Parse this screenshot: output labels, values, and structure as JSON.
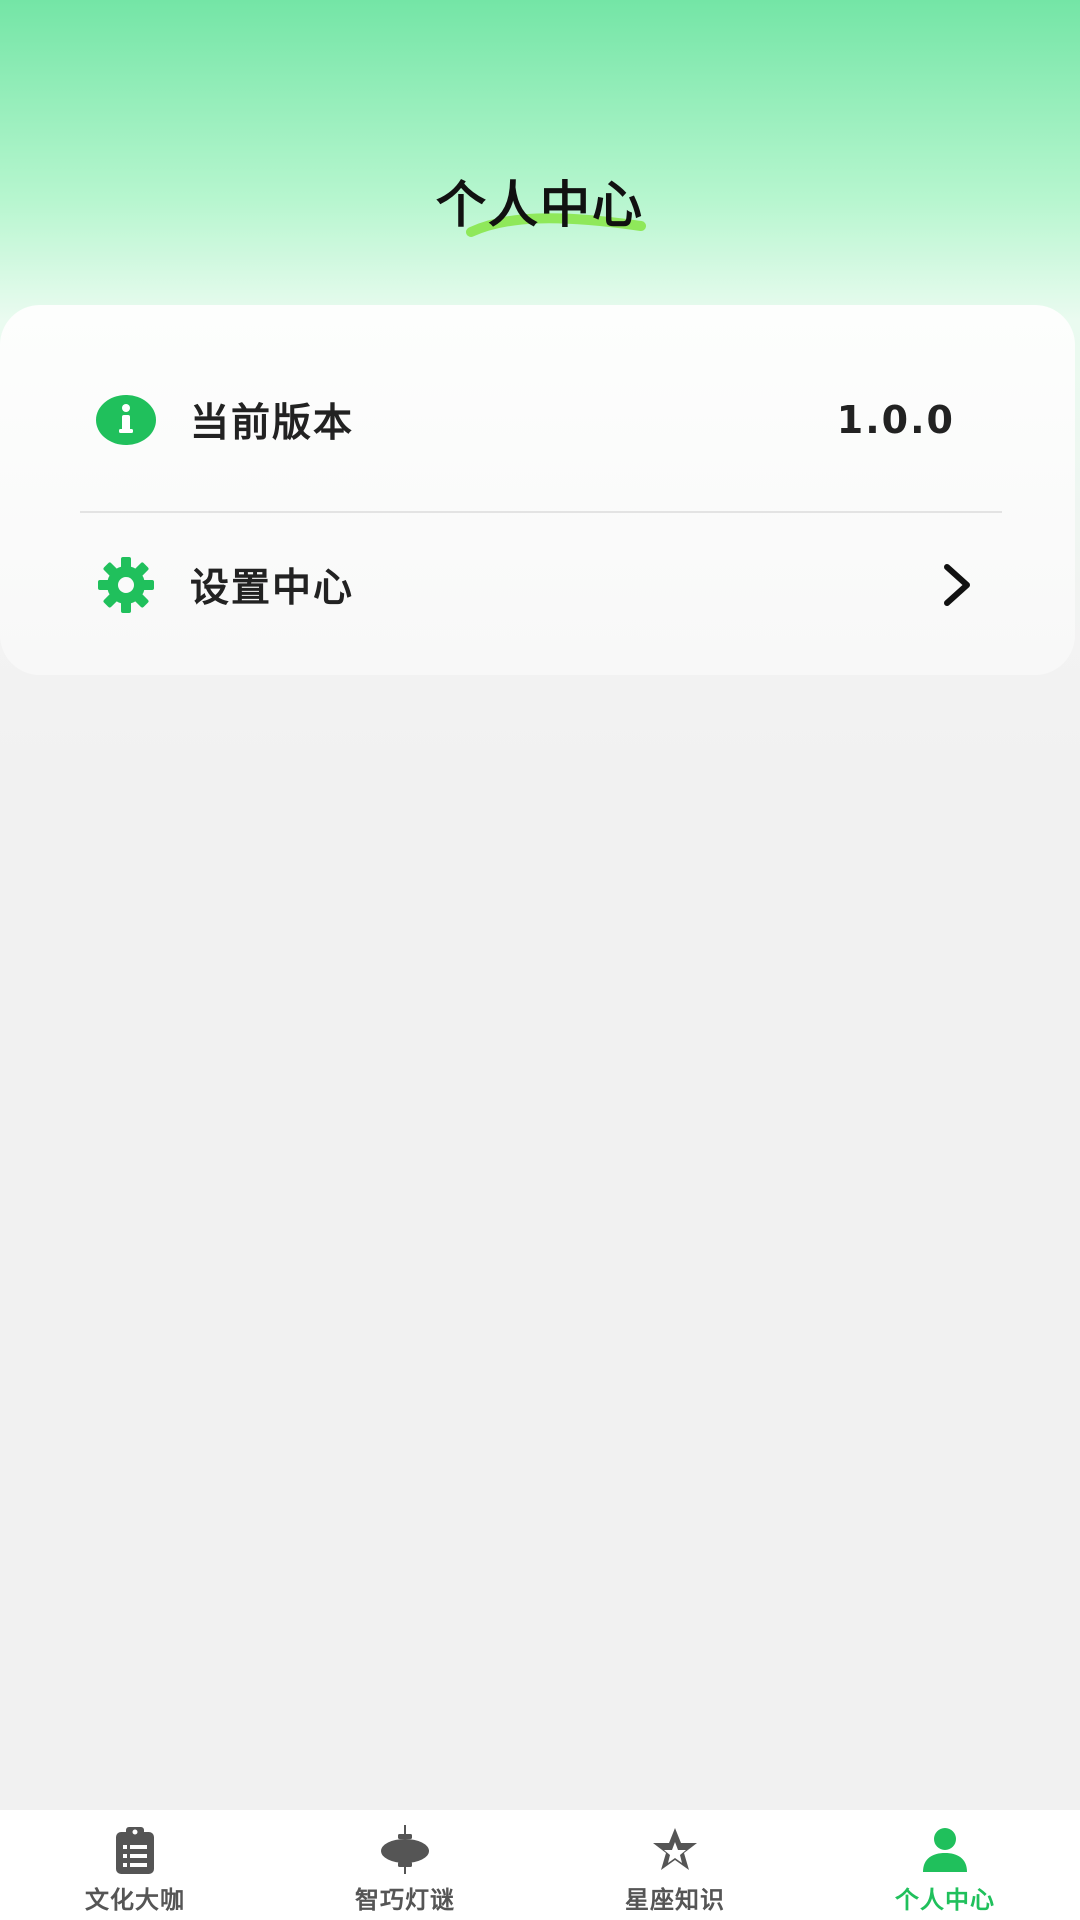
{
  "colors": {
    "accent": "#20c05c",
    "tab_inactive": "#555555",
    "title_underline": "#8fe85a"
  },
  "header": {
    "title": "个人中心"
  },
  "list": {
    "items": [
      {
        "label": "当前版本",
        "value": "1.0.0",
        "icon": "info-icon"
      },
      {
        "label": "设置中心",
        "icon": "gear-icon",
        "trailing_icon": "chevron-right-icon"
      }
    ]
  },
  "tabbar": {
    "tabs": [
      {
        "label": "文化大咖",
        "icon": "clipboard-icon",
        "active": false
      },
      {
        "label": "智巧灯谜",
        "icon": "lantern-icon",
        "active": false
      },
      {
        "label": "星座知识",
        "icon": "star-icon",
        "active": false
      },
      {
        "label": "个人中心",
        "icon": "person-icon",
        "active": true
      }
    ]
  }
}
